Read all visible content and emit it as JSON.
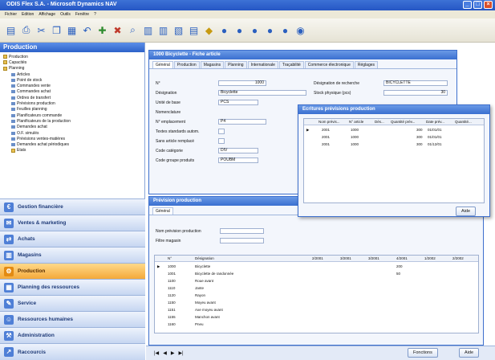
{
  "window_title": "ODIS Flex S.A. - Microsoft Dynamics NAV",
  "menu": [
    "Fichier",
    "Edition",
    "Affichage",
    "Outils",
    "Fenêtre",
    "?"
  ],
  "left": {
    "header": "Production",
    "tree": [
      "Production",
      "Capacités",
      "Planning",
      "Articles",
      "Point de stock",
      "Commandes vente",
      "Commandes achat",
      "Ordres de transfert",
      "Prévisions production",
      "Feuilles planning",
      "Planificateurs commande",
      "Planificateurs de la production",
      "Demandes achat",
      "O.F. simulés",
      "Prévisions ventes-matières",
      "Demandes achat périodiques",
      "Etats"
    ],
    "nav": [
      "Gestion financière",
      "Ventes & marketing",
      "Achats",
      "Magasins",
      "Production",
      "Planning des ressources",
      "Service",
      "Ressources humaines",
      "Administration",
      "Raccourcis"
    ]
  },
  "card": {
    "title": "1000 Bicyclette - Fiche article",
    "tabs": [
      "Général",
      "Production",
      "Magasins",
      "Planning",
      "Internationale",
      "Traçabilité",
      "Commerce électronique",
      "Réglages"
    ],
    "fields": [
      {
        "label": "N°",
        "value": "1000"
      },
      {
        "label": "Désignation",
        "value": "Bicyclette"
      },
      {
        "label": "Unité de base",
        "value": "PCS"
      },
      {
        "label": "Nomenclature",
        "value": ""
      },
      {
        "label": "N° emplacement",
        "value": "P4"
      },
      {
        "label": "Textes standards autom.",
        "value": ""
      },
      {
        "label": "Sans article remplacé",
        "value": ""
      },
      {
        "label": "Code catégorie",
        "value": "DIV"
      },
      {
        "label": "Code groupe produits",
        "value": "POUBM"
      }
    ],
    "right_fields": [
      {
        "label": "Désignation de recherche",
        "value": "BICYCLETTE"
      },
      {
        "label": "Stock physique (pcs)",
        "value": "30"
      }
    ]
  },
  "popup": {
    "title": "Ecritures prévisions production",
    "columns": [
      "Nom prévis...",
      "N° article",
      "Dés...",
      "Quantité prév...",
      "Date prév...",
      "Quantité..."
    ],
    "rows": [
      [
        "2001",
        "1000",
        "",
        "300",
        "01/01/01",
        ""
      ],
      [
        "2001",
        "1000",
        "",
        "300",
        "01/01/01",
        ""
      ],
      [
        "2001",
        "1000",
        "",
        "300",
        "01/12/01",
        ""
      ]
    ],
    "ok_button": "Aide"
  },
  "forecast": {
    "title": "Prévision production",
    "tab": "Général",
    "fields": [
      {
        "label": "Nom prévision production",
        "value": ""
      },
      {
        "label": "Filtre magasin",
        "value": ""
      }
    ],
    "col_no": "N°",
    "col_desc": "Désignation",
    "periods": [
      "2/2001",
      "3/2001",
      "3/2001",
      "4/2001",
      "1/2002",
      "2/2002"
    ],
    "rows": [
      {
        "no": "1000",
        "desc": "Bicyclette",
        "v1": "",
        "v2": "",
        "v3": "",
        "v4": "200",
        "v5": ""
      },
      {
        "no": "1001",
        "desc": "Bicyclette de randonnée",
        "v1": "",
        "v2": "",
        "v3": "",
        "v4": "50",
        "v5": ""
      },
      {
        "no": "1100",
        "desc": "Roue avant",
        "v1": "",
        "v2": "",
        "v3": "",
        "v4": "",
        "v5": ""
      },
      {
        "no": "1110",
        "desc": "Jante",
        "v1": "",
        "v2": "",
        "v3": "",
        "v4": "",
        "v5": ""
      },
      {
        "no": "1120",
        "desc": "Rayon",
        "v1": "",
        "v2": "",
        "v3": "",
        "v4": "",
        "v5": ""
      },
      {
        "no": "1150",
        "desc": "Moyeu avant",
        "v1": "",
        "v2": "",
        "v3": "",
        "v4": "",
        "v5": ""
      },
      {
        "no": "1151",
        "desc": "Axe moyeu avant",
        "v1": "",
        "v2": "",
        "v3": "",
        "v4": "",
        "v5": ""
      },
      {
        "no": "1155",
        "desc": "Manchon avant",
        "v1": "",
        "v2": "",
        "v3": "",
        "v4": "",
        "v5": ""
      },
      {
        "no": "1160",
        "desc": "Pneu",
        "v1": "",
        "v2": "",
        "v3": "",
        "v4": "",
        "v5": ""
      }
    ],
    "buttons": [
      "Fonctions",
      "Aide"
    ]
  }
}
